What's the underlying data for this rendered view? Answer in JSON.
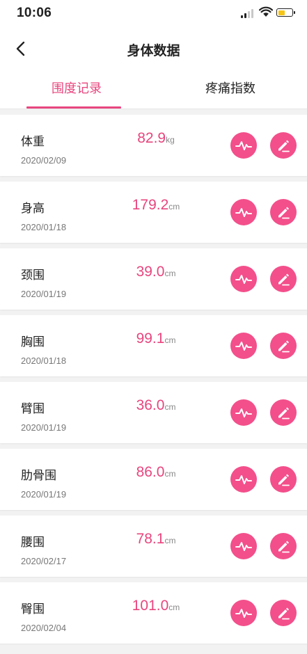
{
  "status_bar": {
    "time": "10:06"
  },
  "nav": {
    "title": "身体数据"
  },
  "tabs": [
    {
      "label": "围度记录",
      "active": true
    },
    {
      "label": "疼痛指数",
      "active": false
    }
  ],
  "colors": {
    "accent": "#e8457e",
    "button": "#f34f8b",
    "battery": "#f5c518"
  },
  "icons": {
    "back": "chevron-left-icon",
    "chart": "line-chart-icon",
    "edit": "pencil-icon"
  },
  "records": [
    {
      "name": "体重",
      "value": "82.9",
      "unit": "kg",
      "date": "2020/02/09"
    },
    {
      "name": "身高",
      "value": "179.2",
      "unit": "cm",
      "date": "2020/01/18"
    },
    {
      "name": "颈围",
      "value": "39.0",
      "unit": "cm",
      "date": "2020/01/19"
    },
    {
      "name": "胸围",
      "value": "99.1",
      "unit": "cm",
      "date": "2020/01/18"
    },
    {
      "name": "臂围",
      "value": "36.0",
      "unit": "cm",
      "date": "2020/01/19"
    },
    {
      "name": "肋骨围",
      "value": "86.0",
      "unit": "cm",
      "date": "2020/01/19"
    },
    {
      "name": "腰围",
      "value": "78.1",
      "unit": "cm",
      "date": "2020/02/17"
    },
    {
      "name": "臀围",
      "value": "101.0",
      "unit": "cm",
      "date": "2020/02/04"
    }
  ]
}
